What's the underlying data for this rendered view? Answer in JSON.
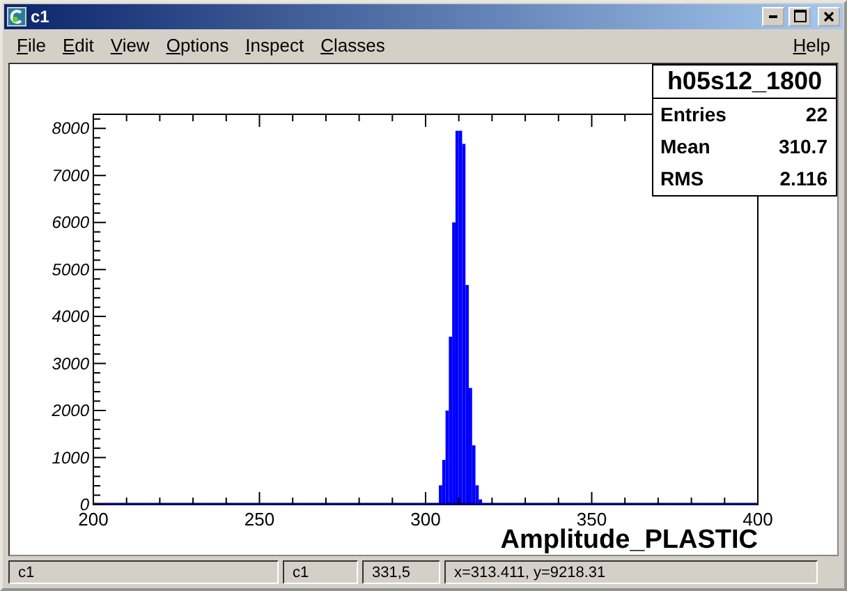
{
  "window": {
    "title": "c1"
  },
  "menu": [
    {
      "label": "File"
    },
    {
      "label": "Edit"
    },
    {
      "label": "View"
    },
    {
      "label": "Options"
    },
    {
      "label": "Inspect"
    },
    {
      "label": "Classes"
    }
  ],
  "help": {
    "label": "Help"
  },
  "canvas": {
    "stats": {
      "title": "h05s12_1800",
      "rows": [
        {
          "label": "Entries",
          "value": "22"
        },
        {
          "label": "Mean",
          "value": "310.7"
        },
        {
          "label": "RMS",
          "value": "2.116"
        }
      ]
    },
    "chart_data": {
      "type": "bar",
      "xlabel": "Amplitude_PLASTIC",
      "x": [
        304.5,
        305.5,
        306.5,
        307.5,
        308.5,
        309.5,
        310.5,
        311.5,
        312.5,
        313.5,
        314.5,
        315.5,
        316.5
      ],
      "series": [
        {
          "color": "#0000ff",
          "values": [
            410,
            950,
            2000,
            3570,
            6000,
            7950,
            7950,
            7670,
            4670,
            2480,
            1260,
            410,
            110
          ]
        }
      ],
      "xlim": [
        200,
        400
      ],
      "ylim": [
        0,
        8300
      ],
      "xticks": [
        200,
        250,
        300,
        350,
        400
      ],
      "yticks": [
        0,
        1000,
        2000,
        3000,
        4000,
        5000,
        6000,
        7000,
        8000
      ]
    }
  },
  "status_bar": [
    "c1",
    "c1",
    "331,5",
    "x=313.411, y=9218.31"
  ]
}
